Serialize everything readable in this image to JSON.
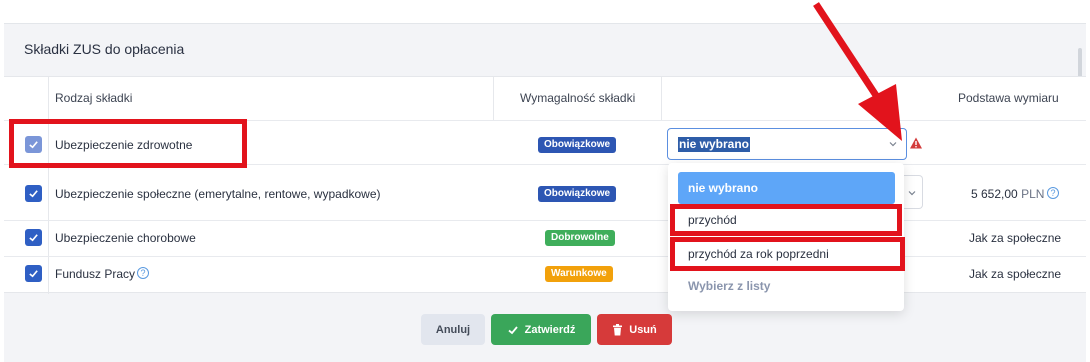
{
  "card": {
    "title": "Składki ZUS do opłacenia"
  },
  "table": {
    "headers": {
      "type": "Rodzaj składki",
      "requirement": "Wymagalność składki",
      "base": "Podstawa wymiaru"
    },
    "rows": [
      {
        "name": "Ubezpieczenie zdrowotne",
        "badge": "Obowiązkowe",
        "badge_color": "#2d56b3",
        "base": "",
        "checked": true
      },
      {
        "name": "Ubezpieczenie społeczne (emerytalne, rentowe, wypadkowe)",
        "badge": "Obowiązkowe",
        "badge_color": "#2d56b3",
        "base_value": "5 652,00",
        "base_unit": "PLN",
        "checked": true
      },
      {
        "name": "Ubezpieczenie chorobowe",
        "badge": "Dobrowolne",
        "badge_color": "#3fae5b",
        "base": "Jak za społeczne",
        "checked": true
      },
      {
        "name": "Fundusz Pracy",
        "badge": "Warunkowe",
        "badge_color": "#f2a10b",
        "base": "Jak za społeczne",
        "checked": true
      }
    ]
  },
  "select": {
    "value": "nie wybrano",
    "options": [
      "nie wybrano",
      "przychód",
      "przychód za rok poprzedni",
      "Wybierz z listy"
    ]
  },
  "buttons": {
    "cancel": "Anuluj",
    "confirm": "Zatwierdź",
    "delete": "Usuń"
  },
  "colors": {
    "accent": "#2f5fc4",
    "highlight": "#e2131c",
    "success": "#3aa65a",
    "danger": "#d63a3a"
  },
  "icons": {
    "checkbox": "check-icon",
    "help": "question-circle-icon",
    "warning": "warning-triangle-icon",
    "chevron": "chevron-down-icon",
    "confirm": "check-icon",
    "delete": "trash-icon"
  }
}
